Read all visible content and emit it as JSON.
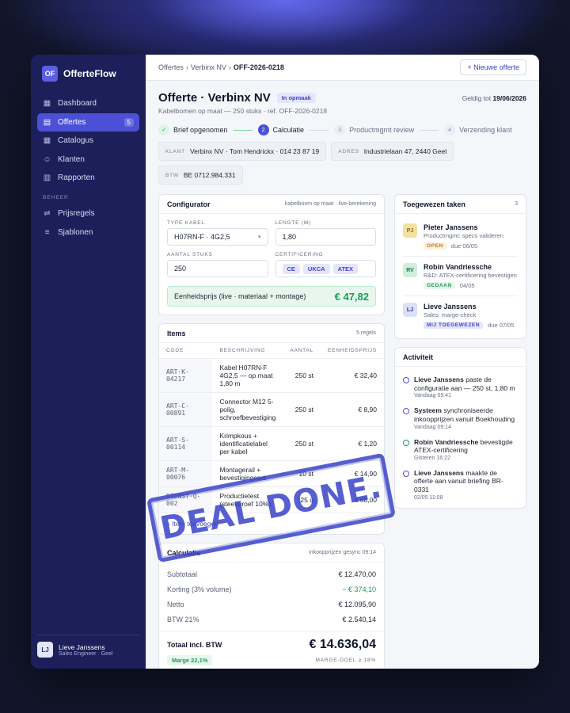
{
  "brand": {
    "logo": "OF",
    "name": "OfferteFlow"
  },
  "sidebar": {
    "items": [
      {
        "label": "Dashboard",
        "icon": "grid-icon"
      },
      {
        "label": "Offertes",
        "icon": "document-icon",
        "badge": "5",
        "active": true
      },
      {
        "label": "Catalogus",
        "icon": "catalog-icon"
      },
      {
        "label": "Klanten",
        "icon": "users-icon"
      },
      {
        "label": "Rapporten",
        "icon": "chart-icon"
      }
    ],
    "section": "BEHEER",
    "admin_items": [
      {
        "label": "Prijsregels",
        "icon": "sliders-icon"
      },
      {
        "label": "Sjablonen",
        "icon": "list-icon"
      }
    ],
    "user": {
      "initials": "LJ",
      "name": "Lieve Janssens",
      "role": "Sales Engineer · Geel"
    }
  },
  "topbar": {
    "breadcrumb": [
      "Offertes",
      "Verbinx NV",
      "OFF-2026-0218"
    ],
    "new_button": "+ Nieuwe offerte"
  },
  "header": {
    "title": "Offerte · Verbinx NV",
    "status": "In opmaak",
    "valid_label": "Geldig tot",
    "valid_date": "19/06/2026",
    "subtitle": "Kabelbomen op maat — 250 stuks · ref. OFF-2026-0218"
  },
  "steps": [
    {
      "num": "✓",
      "label": "Brief opgenomen"
    },
    {
      "num": "2",
      "label": "Calculatie"
    },
    {
      "num": "3",
      "label": "Productmgmt review"
    },
    {
      "num": "4",
      "label": "Verzending klant"
    }
  ],
  "chips": [
    {
      "key": "KLANT",
      "value": "Verbinx NV · Tom Hendrickx · 014 23 87 19"
    },
    {
      "key": "ADRES",
      "value": "Industrielaan 47, 2440 Geel"
    },
    {
      "key": "BTW",
      "value": "BE 0712.984.331"
    }
  ],
  "configurator": {
    "title": "Configurator",
    "meta": "kabelboom op maat · live-berekening",
    "type_label": "TYPE KABEL",
    "type_value": "H07RN-F · 4G2,5",
    "length_label": "LENGTE (M)",
    "length_value": "1,80",
    "qty_label": "AANTAL STUKS",
    "qty_value": "250",
    "cert_label": "CERTIFICERING",
    "certs": [
      "CE",
      "UKCA",
      "ATEX"
    ],
    "price_label": "Eenheidsprijs (live · materiaal + montage)",
    "price_value": "€ 47,82"
  },
  "items": {
    "title": "Items",
    "meta": "5 regels",
    "columns": [
      "CODE",
      "BESCHRIJVING",
      "AANTAL",
      "EENHEIDSPRIJS"
    ],
    "rows": [
      {
        "code": "ART-K-04217",
        "desc": "Kabel H07RN-F 4G2,5 — op maat 1,80 m",
        "qty": "250 st",
        "price": "€ 32,40"
      },
      {
        "code": "ART-C-00891",
        "desc": "Connector M12 5-polig, schroefbevestiging",
        "qty": "250 st",
        "price": "€ 8,90"
      },
      {
        "code": "ART-S-00114",
        "desc": "Krimpkous + identificatielabel per kabel",
        "qty": "250 st",
        "price": "€ 1,20"
      },
      {
        "code": "ART-M-00076",
        "desc": "Montagerail + bevestigingsset",
        "qty": "10 st",
        "price": "€ 14,90"
      },
      {
        "code": "DIENST-Q-002",
        "desc": "Productietest (steekproef 10%)",
        "qty": "25 u",
        "price": "€ 68,00"
      }
    ],
    "add_label": "+ Item toevoegen"
  },
  "calc": {
    "title": "Calculatie",
    "meta": "inkoopprijzen gesync 09:14",
    "rows": [
      {
        "label": "Subtotaal",
        "value": "€ 12.470,00"
      },
      {
        "label": "Korting (3% volume)",
        "value": "− € 374,10"
      },
      {
        "label": "Netto",
        "value": "€ 12.095,90"
      },
      {
        "label": "BTW 21%",
        "value": "€ 2.540,14"
      }
    ],
    "total_label": "Totaal incl. BTW",
    "total_value": "€ 14.636,04",
    "margin": "Marge 22,1%",
    "margin_goal": "MARGE-DOEL ≥ 18%"
  },
  "tasks": {
    "title": "Toegewezen taken",
    "count": "3",
    "list": [
      {
        "initials": "PJ",
        "name": "Pieter Janssens",
        "desc": "Productmgmt: specs valideren",
        "status": "OPEN",
        "due": "due 06/05",
        "color": "#f3e1a0",
        "text_color": "#8a6a10",
        "status_bg": "#fdf0dc",
        "status_color": "#c27a12"
      },
      {
        "initials": "RV",
        "name": "Robin Vandriessche",
        "desc": "R&D: ATEX-certificering bevestigen",
        "status": "GEDAAN",
        "due": "04/05",
        "color": "#cfeedd",
        "text_color": "#1f7a4a",
        "status_bg": "#e8f7ee",
        "status_color": "#1f9a5a"
      },
      {
        "initials": "LJ",
        "name": "Lieve Janssens",
        "desc": "Sales: marge-check",
        "status": "MIJ TOEGEWEZEN",
        "due": "due 07/05",
        "color": "#dde0fa",
        "text_color": "#2d3183",
        "status_bg": "#e5e6fb",
        "status_color": "#3f43c9"
      }
    ]
  },
  "activity": {
    "title": "Activiteit",
    "list": [
      {
        "who": "Lieve Janssens",
        "what": " paste de configuratie aan — 250 st, 1,80 m",
        "time": "Vandaag 09:41"
      },
      {
        "who": "Systeem",
        "what": " synchroniseerde inkoopprijzen vanuit Boekhouding",
        "time": "Vandaag 09:14"
      },
      {
        "who": "Robin Vandriessche",
        "what": " bevestigde ATEX-certificering",
        "time": "Gisteren 16:22"
      },
      {
        "who": "Lieve Janssens",
        "what": " maakte de offerte aan vanuit briefing BR-0331",
        "time": "02/05 11:08"
      }
    ]
  },
  "stamp": "DEAL DONE.",
  "colors": {
    "accent": "#4c50d6",
    "sidebar": "#1c1f5a",
    "success": "#1f9a5a",
    "stamp": "#3a44c8"
  }
}
